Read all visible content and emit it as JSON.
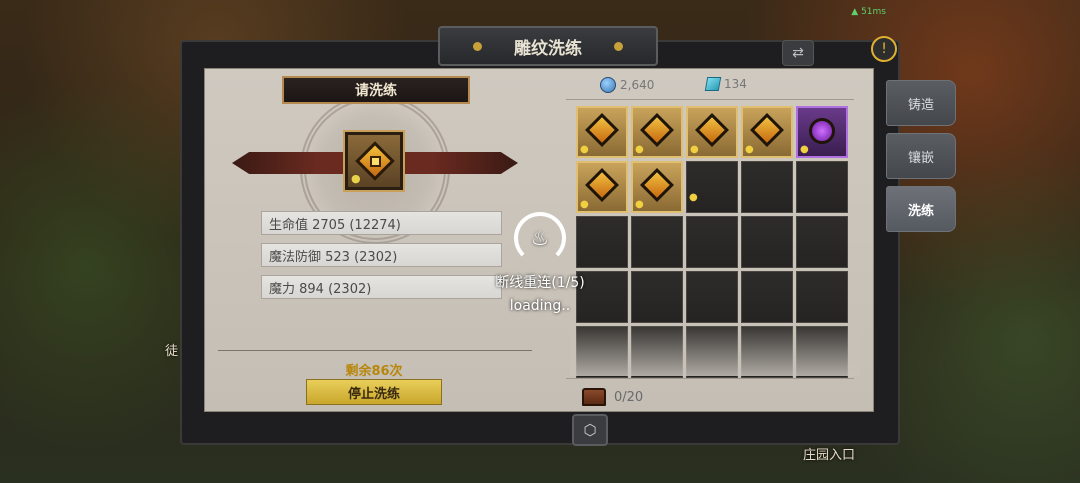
{
  "window": {
    "title": "雕纹洗练",
    "signal": "51ms"
  },
  "side_tabs": [
    {
      "label": "铸造",
      "active": false
    },
    {
      "label": "镶嵌",
      "active": false
    },
    {
      "label": "洗练",
      "active": true
    }
  ],
  "left": {
    "banner": "请洗练",
    "stats": [
      "生命值 2705 (12274)",
      "魔法防御 523 (2302)",
      "魔力 894 (2302)"
    ],
    "remaining": "剩余86次",
    "stop_button": "停止洗练"
  },
  "currencies": {
    "coins": "2,640",
    "crystals": "134"
  },
  "inventory": {
    "capacity": "0/20",
    "items": [
      {
        "type": "gold-gem",
        "equipped": true
      },
      {
        "type": "gold-gem",
        "equipped": true
      },
      {
        "type": "gold-gem",
        "equipped": true
      },
      {
        "type": "gold-gem",
        "equipped": true
      },
      {
        "type": "purple-gem",
        "equipped": true
      },
      {
        "type": "gold-gem",
        "equipped": true
      },
      {
        "type": "gold-gem",
        "equipped": true
      },
      {
        "type": "empty",
        "equipped": true
      }
    ]
  },
  "overlay": {
    "reconnect": "断线重连(1/5)",
    "loading": "loading.."
  },
  "world": {
    "estate_entrance": "庄园入口",
    "left_label": "徒"
  },
  "colors": {
    "accent_gold": "#c9a13a",
    "button_gold": "#e8cf5a",
    "remaining_text": "#b8860b",
    "panel_bg": "#cfc9c0"
  }
}
